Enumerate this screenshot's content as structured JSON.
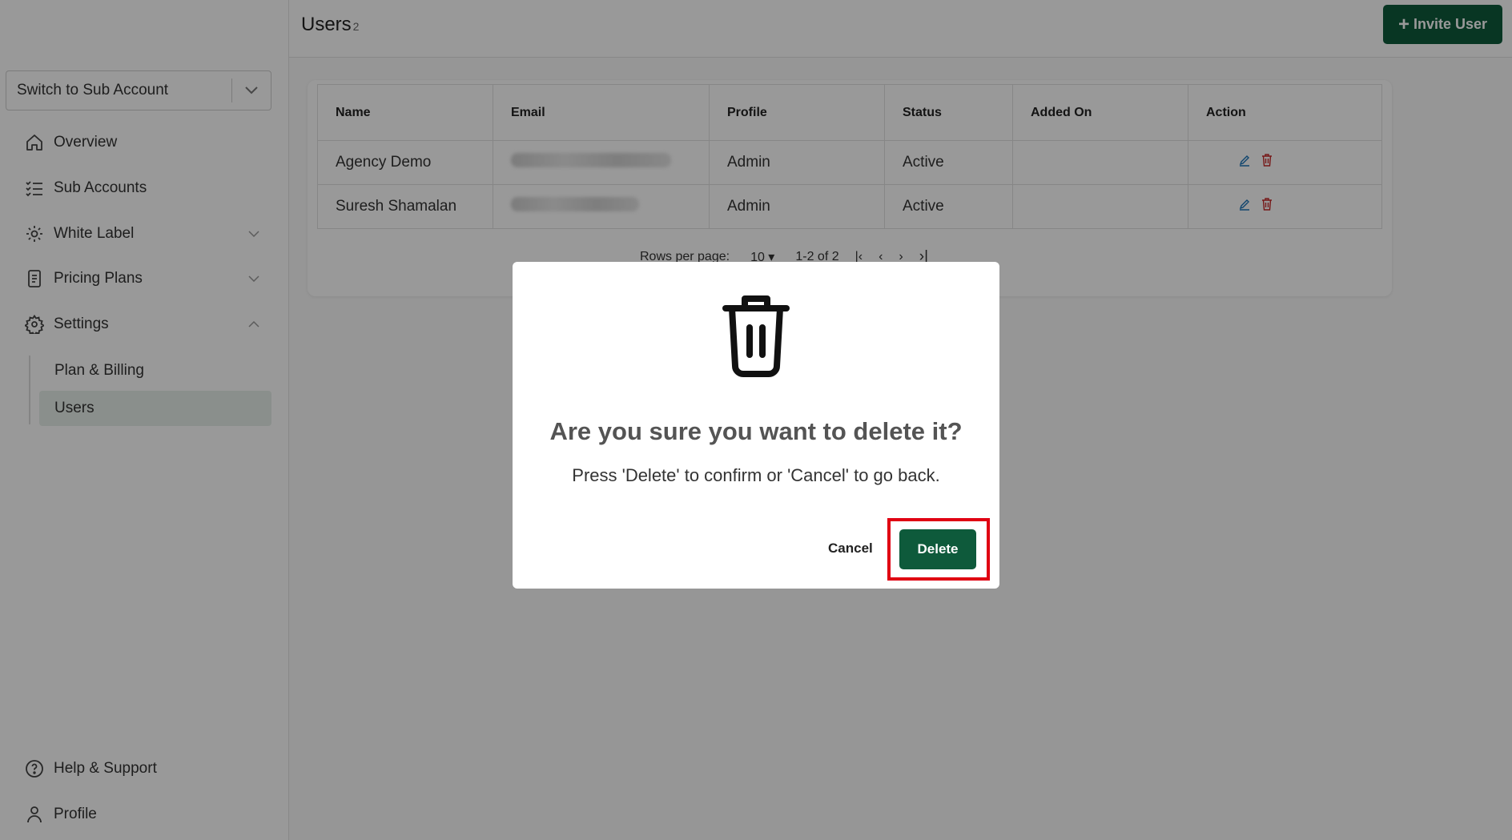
{
  "sidebar": {
    "account_switcher": {
      "label": "Switch to Sub Account"
    },
    "nav": [
      {
        "label": "Overview",
        "icon": "home-icon"
      },
      {
        "label": "Sub Accounts",
        "icon": "list-check-icon"
      },
      {
        "label": "White Label",
        "icon": "gear-icon"
      },
      {
        "label": "Pricing Plans",
        "icon": "document-icon"
      },
      {
        "label": "Settings",
        "icon": "settings-icon"
      }
    ],
    "settings_sub": [
      {
        "label": "Plan & Billing"
      },
      {
        "label": "Users",
        "active": true
      }
    ],
    "footer": [
      {
        "label": "Help & Support",
        "icon": "help-icon"
      },
      {
        "label": "Profile",
        "icon": "user-icon"
      }
    ]
  },
  "header": {
    "title": "Users",
    "count": "2",
    "invite_label": "Invite User"
  },
  "table": {
    "columns": [
      "Name",
      "Email",
      "Profile",
      "Status",
      "Added On",
      "Action"
    ],
    "rows": [
      {
        "name": "Agency Demo",
        "email": "",
        "profile": "Admin",
        "status": "Active",
        "added_on": ""
      },
      {
        "name": "Suresh Shamalan",
        "email": "",
        "profile": "Admin",
        "status": "Active",
        "added_on": ""
      }
    ],
    "pagination": {
      "rows_per_page_label": "Rows per page:",
      "rows_per_page": "10",
      "range": "1-2 of 2"
    }
  },
  "modal": {
    "icon": "trash-icon",
    "title": "Are you sure you want to delete it?",
    "message": "Press 'Delete' to confirm or 'Cancel' to go back.",
    "cancel_label": "Cancel",
    "delete_label": "Delete"
  },
  "colors": {
    "brand": "#0e5a3b",
    "highlight": "#e00012",
    "edit_icon": "#1a73b8",
    "delete_icon": "#c62828"
  }
}
